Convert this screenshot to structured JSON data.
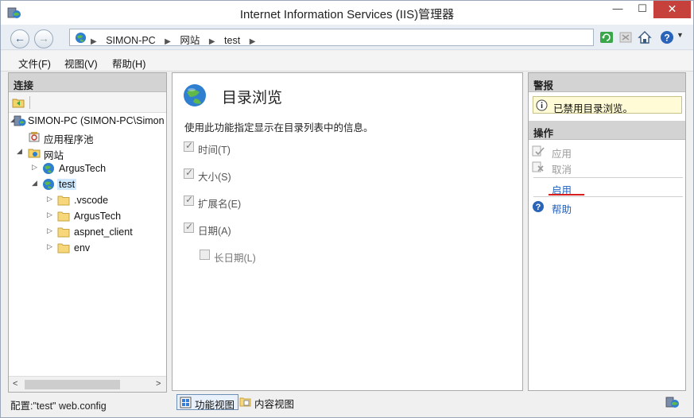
{
  "window": {
    "title": "Internet Information Services (IIS)管理器",
    "min_glyph": "—",
    "max_glyph": "☐",
    "close_glyph": "✕"
  },
  "address": {
    "crumbs": [
      "SIMON-PC",
      "网站",
      "test"
    ],
    "separator": "▶"
  },
  "menu": {
    "items": [
      "文件(F)",
      "视图(V)",
      "帮助(H)"
    ]
  },
  "connections": {
    "title": "连接",
    "tree": [
      {
        "label": "SIMON-PC (SIMON-PC\\Simon",
        "icon": "server-icon",
        "expander": "◢"
      },
      {
        "label": "应用程序池",
        "icon": "app-pool-icon",
        "expander": ""
      },
      {
        "label": "网站",
        "icon": "sites-folder-icon",
        "expander": "◢"
      },
      {
        "label": "ArgusTech",
        "icon": "globe-icon",
        "expander": "▷"
      },
      {
        "label": "test",
        "icon": "globe-icon",
        "expander": "◢"
      },
      {
        "label": ".vscode",
        "icon": "folder-icon",
        "expander": "▷"
      },
      {
        "label": "ArgusTech",
        "icon": "folder-icon",
        "expander": "▷"
      },
      {
        "label": "aspnet_client",
        "icon": "folder-icon",
        "expander": "▷"
      },
      {
        "label": "env",
        "icon": "folder-icon",
        "expander": "▷"
      }
    ],
    "scroll_left": "<",
    "scroll_right": ">"
  },
  "feature": {
    "title": "目录浏览",
    "description": "使用此功能指定显示在目录列表中的信息。",
    "checkboxes": [
      {
        "label": "时间(T)",
        "checked": true
      },
      {
        "label": "大小(S)",
        "checked": true
      },
      {
        "label": "扩展名(E)",
        "checked": true
      },
      {
        "label": "日期(A)",
        "checked": true
      },
      {
        "label": "长日期(L)",
        "checked": false
      }
    ]
  },
  "view_tabs": [
    "功能视图",
    "内容视图"
  ],
  "actions": {
    "alert_title": "警报",
    "alert_text": "已禁用目录浏览。",
    "title": "操作",
    "items": [
      {
        "label": "应用",
        "state": "disabled"
      },
      {
        "label": "取消",
        "state": "disabled"
      },
      {
        "label": "启用",
        "state": "link"
      },
      {
        "label": "帮助",
        "state": "link"
      }
    ]
  },
  "status": {
    "text": "配置:\"test\" web.config"
  },
  "colors": {
    "accent_link": "#1f5fbf",
    "close_red": "#c7413c",
    "alert_bg": "#fffbd6",
    "highlight_underline": "#d81e1e"
  }
}
